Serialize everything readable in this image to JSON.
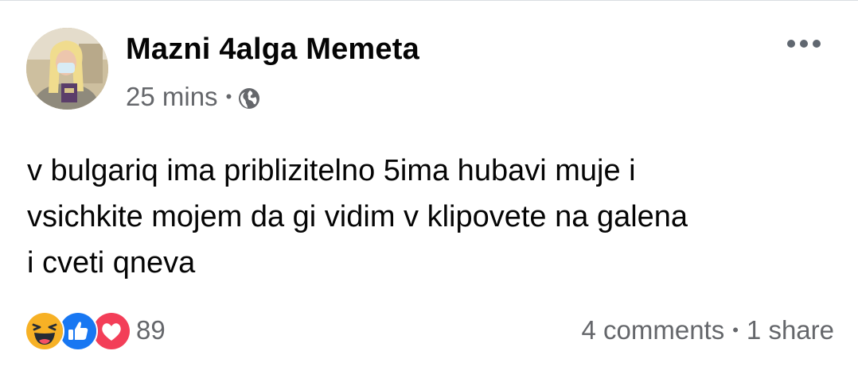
{
  "post": {
    "author": "Mazni 4alga Memeta",
    "time": "25 mins",
    "separator": "•",
    "privacy_icon": "globe-icon",
    "more_icon": "more-dots-icon",
    "text": "v bulgariq ima priblizitelno 5ima hubavi muje i\nvsichkite mojem da gi vidim v klipovete na galena\ni cveti qneva"
  },
  "reactions": {
    "icons": [
      "haha-reaction-icon",
      "like-reaction-icon",
      "love-reaction-icon"
    ],
    "count": "89"
  },
  "engagement": {
    "comments": "4 comments",
    "separator": "•",
    "shares": "1 share"
  },
  "colors": {
    "secondary_text": "#65676b",
    "like_blue": "#1877f2",
    "love_red": "#f33e58",
    "haha_yellow": "#f7b125"
  }
}
